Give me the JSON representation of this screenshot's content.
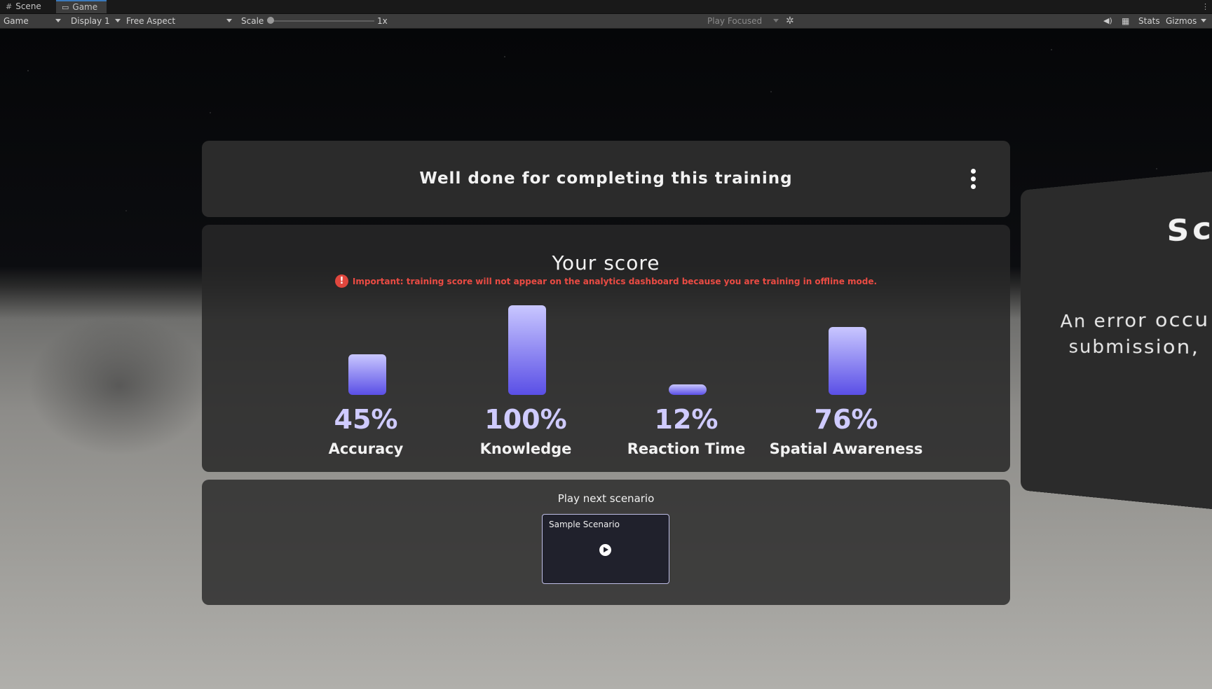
{
  "editor": {
    "tabs": [
      {
        "label": "Scene",
        "icon": "grid-icon"
      },
      {
        "label": "Game",
        "icon": "gamepad-icon"
      }
    ],
    "toolbar": {
      "view_dropdown": "Game",
      "display_dropdown": "Display 1",
      "aspect_dropdown": "Free Aspect",
      "scale_label": "Scale",
      "scale_value": "1x",
      "scale_level": 0,
      "play_mode_dropdown": "Play Focused",
      "stats_label": "Stats",
      "gizmos_label": "Gizmos"
    }
  },
  "game": {
    "header": {
      "title": "Well done for completing this training"
    },
    "score": {
      "title": "Your score",
      "warning": "Important: training score will not appear on the analytics dashboard because you are training in offline mode.",
      "warning_icon": "!",
      "metrics": [
        {
          "value": "45%",
          "label": "Accuracy",
          "level": 45
        },
        {
          "value": "100%",
          "label": "Knowledge",
          "level": 100
        },
        {
          "value": "12%",
          "label": "Reaction Time",
          "level": 12
        },
        {
          "value": "76%",
          "label": "Spatial Awareness",
          "level": 76
        }
      ],
      "bar_gradient": [
        "#c9c7ff",
        "#5a4fe6"
      ]
    },
    "next": {
      "label": "Play next scenario",
      "scenario_title": "Sample Scenario"
    },
    "side_panel": {
      "title": "Sco",
      "line1": "An error occu",
      "line2": "submission,"
    }
  }
}
